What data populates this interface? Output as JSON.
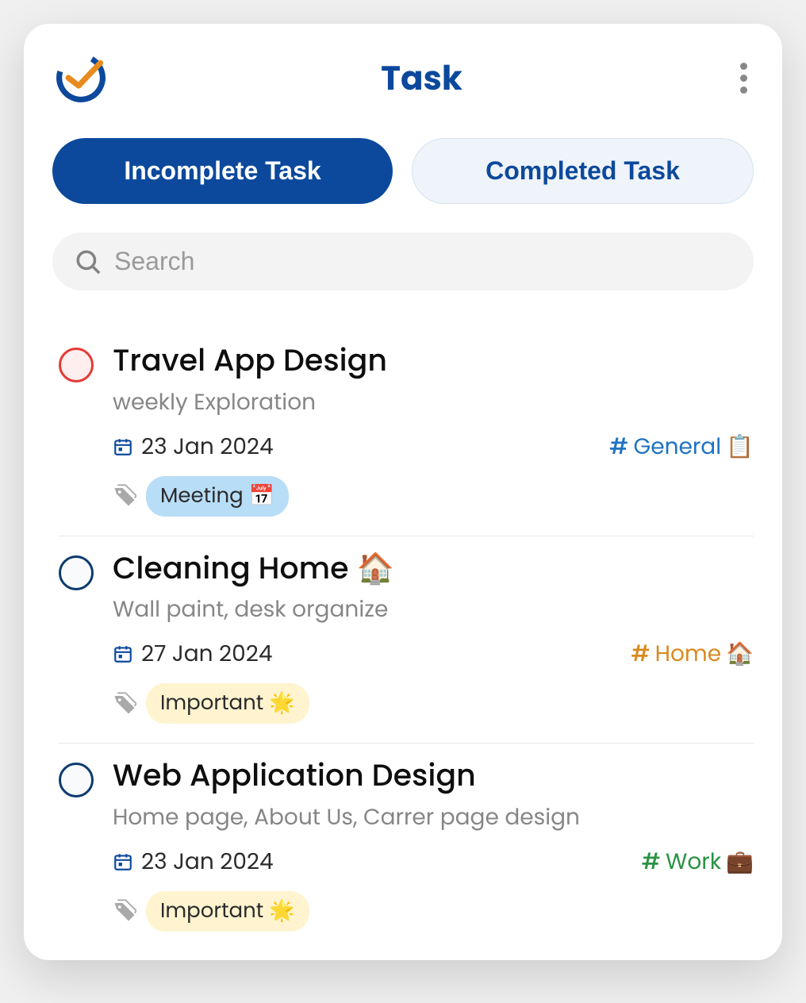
{
  "header": {
    "title": "Task"
  },
  "tabs": {
    "incomplete": "Incomplete Task",
    "completed": "Completed Task"
  },
  "search": {
    "placeholder": "Search"
  },
  "tasks": [
    {
      "title": "Travel App Design",
      "subtitle": "weekly Exploration",
      "date": "23 Jan 2024",
      "category_label": "General",
      "category_emoji": "📋",
      "category_class": "cat-general",
      "tag_label": "Meeting 📅",
      "tag_class": "tag-meeting",
      "priority": true
    },
    {
      "title": "Cleaning Home 🏠",
      "subtitle": "Wall paint, desk organize",
      "date": "27 Jan 2024",
      "category_label": "Home",
      "category_emoji": "🏠",
      "category_class": "cat-home",
      "tag_label": "Important 🌟",
      "tag_class": "tag-important",
      "priority": false
    },
    {
      "title": "Web Application Design",
      "subtitle": "Home page, About Us, Carrer page design",
      "date": "23 Jan 2024",
      "category_label": "Work",
      "category_emoji": "💼",
      "category_class": "cat-work",
      "tag_label": "Important 🌟",
      "tag_class": "tag-important",
      "priority": false
    }
  ]
}
